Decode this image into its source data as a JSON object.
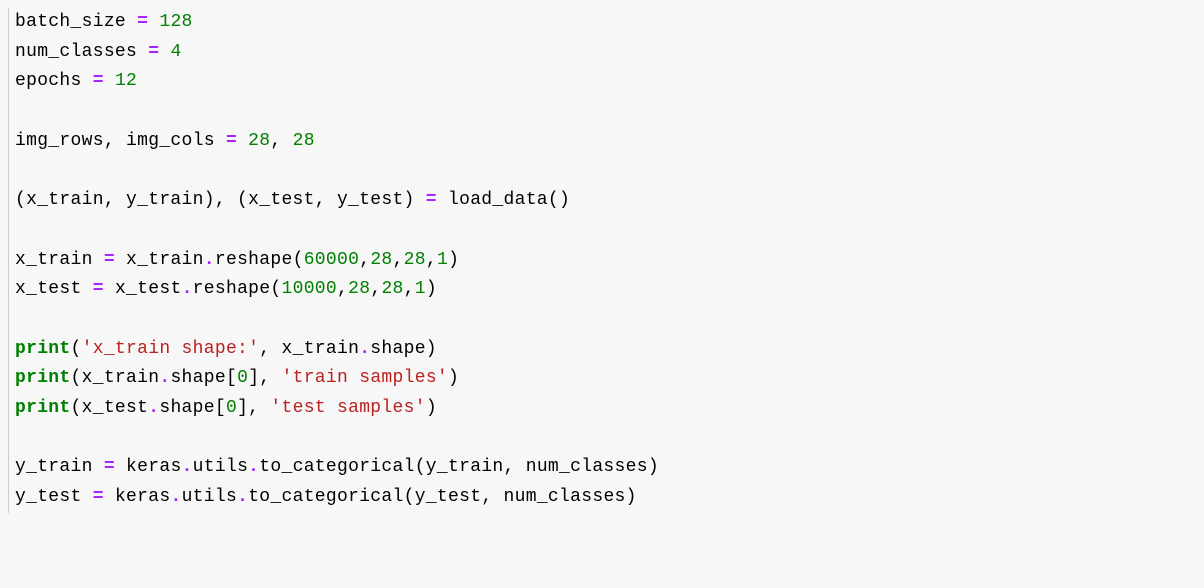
{
  "code": {
    "line1": {
      "var": "batch_size",
      "eq": " = ",
      "val": "128"
    },
    "line2": {
      "var": "num_classes",
      "eq": " = ",
      "val": "4"
    },
    "line3": {
      "var": "epochs",
      "eq": " = ",
      "val": "12"
    },
    "line5": {
      "p1": "img_rows, img_cols",
      "eq": " = ",
      "v1": "28",
      "comma": ", ",
      "v2": "28"
    },
    "line7": {
      "p1": "(x_train, y_train), (x_test, y_test)",
      "eq": " = ",
      "p2": "load_data()"
    },
    "line9": {
      "p1": "x_train",
      "eq": " = ",
      "p2": "x_train",
      "dot": ".",
      "p3": "reshape(",
      "v1": "60000",
      "c1": ",",
      "v2": "28",
      "c2": ",",
      "v3": "28",
      "c3": ",",
      "v4": "1",
      "p4": ")"
    },
    "line10": {
      "p1": "x_test",
      "eq": " = ",
      "p2": "x_test",
      "dot": ".",
      "p3": "reshape(",
      "v1": "10000",
      "c1": ",",
      "v2": "28",
      "c2": ",",
      "v3": "28",
      "c3": ",",
      "v4": "1",
      "p4": ")"
    },
    "line12": {
      "fn": "print",
      "p1": "(",
      "s1": "'x_train shape:'",
      "c1": ", x_train",
      "dot": ".",
      "p2": "shape)"
    },
    "line13": {
      "fn": "print",
      "p1": "(x_train",
      "dot": ".",
      "p2": "shape[",
      "v1": "0",
      "p3": "], ",
      "s1": "'train samples'",
      "p4": ")"
    },
    "line14": {
      "fn": "print",
      "p1": "(x_test",
      "dot": ".",
      "p2": "shape[",
      "v1": "0",
      "p3": "], ",
      "s1": "'test samples'",
      "p4": ")"
    },
    "line16": {
      "p1": "y_train",
      "eq": " = ",
      "p2": "keras",
      "d1": ".",
      "p3": "utils",
      "d2": ".",
      "p4": "to_categorical(y_train, num_classes)"
    },
    "line17": {
      "p1": "y_test",
      "eq": " = ",
      "p2": "keras",
      "d1": ".",
      "p3": "utils",
      "d2": ".",
      "p4": "to_categorical(y_test, num_classes)"
    }
  }
}
